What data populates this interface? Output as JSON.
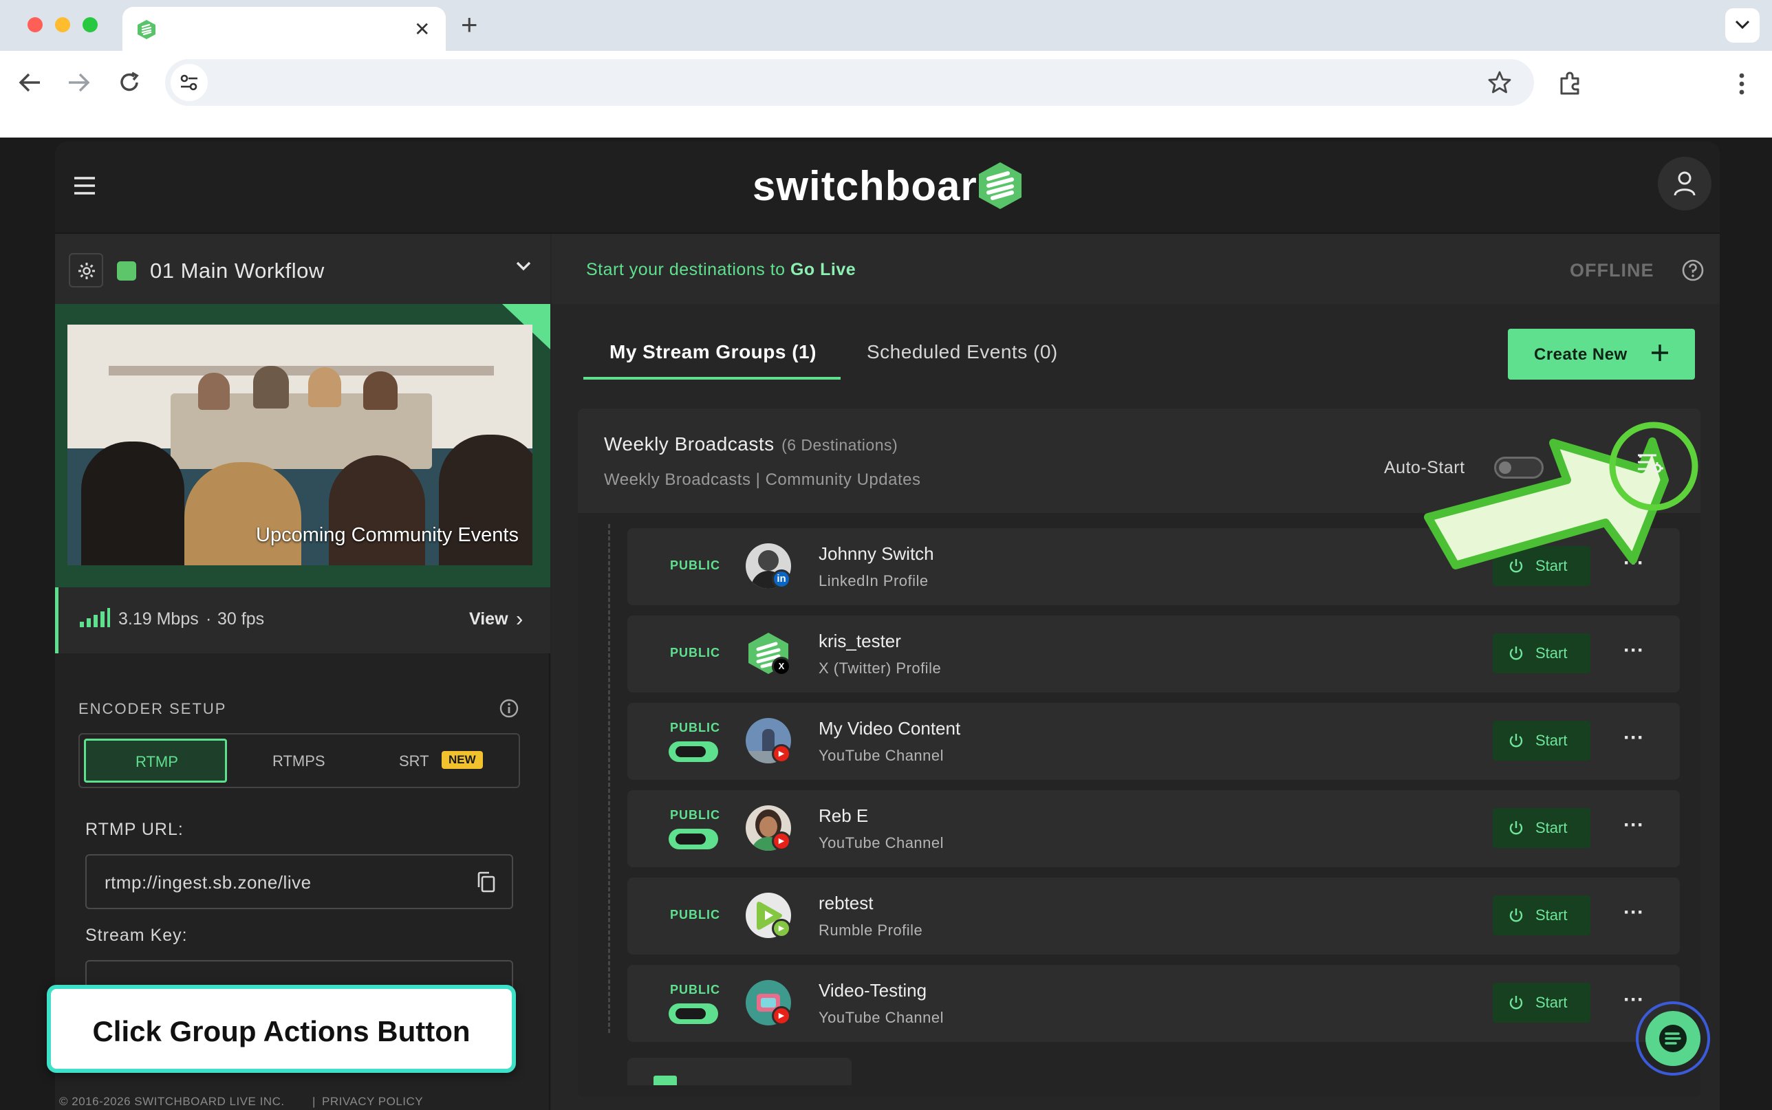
{
  "browser": {
    "new_tab_symbol": "+",
    "close_tab_symbol": "✕",
    "tab_search_symbol": "⌄"
  },
  "header": {
    "logo_text": "switchboard"
  },
  "workflow": {
    "name": "01 Main Workflow"
  },
  "preview": {
    "overlay_text": "Upcoming Community Events"
  },
  "stats": {
    "bitrate": "3.19 Mbps",
    "separator": "·",
    "fps": "30 fps",
    "view_label": "View",
    "view_chevron": "›"
  },
  "encoder": {
    "section_title": "ENCODER SETUP",
    "tabs": [
      "RTMP",
      "RTMPS",
      "SRT"
    ],
    "new_badge": "NEW",
    "rtmp_url_label": "RTMP URL:",
    "rtmp_url_value": "rtmp://ingest.sb.zone/live",
    "stream_key_label": "Stream Key:"
  },
  "status_bar": {
    "prefix": "Start your destinations to ",
    "emphasis": "Go Live",
    "state": "OFFLINE"
  },
  "main_tabs": [
    "My Stream Groups (1)",
    "Scheduled Events (0)"
  ],
  "create_button_label": "Create New",
  "group": {
    "title": "Weekly Broadcasts",
    "count": "(6 Destinations)",
    "subtitle_a": "Weekly Broadcasts",
    "subtitle_sep": "|",
    "subtitle_b": "Community Updates",
    "auto_start_label": "Auto-Start"
  },
  "destinations": [
    {
      "visibility": "PUBLIC",
      "toggle": false,
      "name": "Johnny Switch",
      "type": "LinkedIn Profile",
      "platform": "linkedin",
      "start_label": "Start"
    },
    {
      "visibility": "PUBLIC",
      "toggle": false,
      "name": "kris_tester",
      "type": "X (Twitter) Profile",
      "platform": "x",
      "start_label": "Start"
    },
    {
      "visibility": "PUBLIC",
      "toggle": true,
      "name": "My Video Content",
      "type": "YouTube Channel",
      "platform": "youtube",
      "start_label": "Start"
    },
    {
      "visibility": "PUBLIC",
      "toggle": true,
      "name": "Reb E",
      "type": "YouTube Channel",
      "platform": "youtube",
      "start_label": "Start"
    },
    {
      "visibility": "PUBLIC",
      "toggle": false,
      "name": "rebtest",
      "type": "Rumble Profile",
      "platform": "rumble",
      "start_label": "Start"
    },
    {
      "visibility": "PUBLIC",
      "toggle": true,
      "name": "Video-Testing",
      "type": "YouTube Channel",
      "platform": "youtube",
      "start_label": "Start"
    }
  ],
  "more_symbol": "···",
  "footer": {
    "copyright": "© 2016-2026 SWITCHBOARD LIVE INC.",
    "separator": "|",
    "privacy": "PRIVACY POLICY"
  },
  "callout": {
    "text": "Click Group Actions Button"
  },
  "colors": {
    "accent_green": "#5ee08e",
    "start_bg": "#16401f",
    "highlight_ring": "#5ed23a",
    "callout_border": "#3fe0c8"
  },
  "icons": [
    "menu-icon",
    "switchboard-logo-icon",
    "user-icon",
    "gear-icon",
    "chevron-down-icon",
    "signal-icon",
    "info-icon",
    "copy-icon",
    "help-icon",
    "plus-icon",
    "group-actions-icon",
    "power-icon",
    "more-icon",
    "chat-icon",
    "back-icon",
    "forward-icon",
    "reload-icon",
    "site-settings-icon",
    "bookmark-star-icon",
    "extensions-icon",
    "kebab-menu-icon"
  ]
}
